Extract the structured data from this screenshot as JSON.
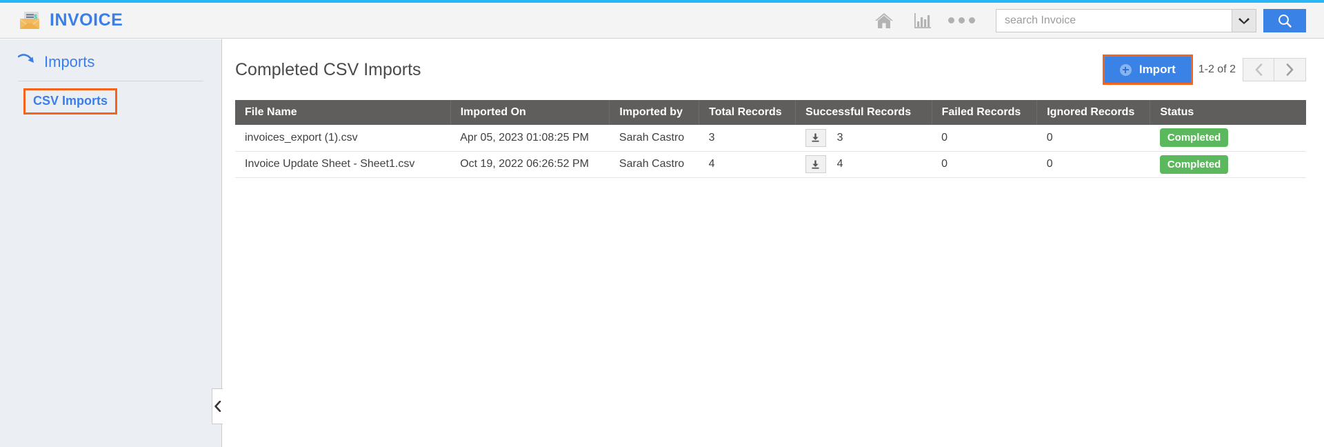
{
  "theme": {
    "accent_bar": "#29b6f6",
    "brand_blue": "#3b7ee8",
    "button_blue": "#3b82e6",
    "highlight_orange": "#f4641b",
    "table_header_gray": "#5f5e5c",
    "status_green": "#5cb85c",
    "sidebar_bg": "#ebeff4"
  },
  "header": {
    "brand_title": "INVOICE",
    "logo_icon": "envelope-invoice-icon",
    "home_icon": "home-icon",
    "analytics_icon": "bar-chart-icon",
    "more_icon": "more-dots-icon",
    "search": {
      "placeholder": "search Invoice",
      "value": "",
      "dropdown_icon": "chevron-down-icon",
      "button_icon": "search-icon"
    }
  },
  "sidebar": {
    "section_icon": "curved-arrow-icon",
    "section_label": "Imports",
    "items": [
      {
        "label": "CSV Imports",
        "selected": true
      }
    ],
    "collapse_icon": "chevron-left-icon"
  },
  "main": {
    "page_title": "Completed CSV Imports",
    "import_button": {
      "label": "Import",
      "icon": "plus-circle-icon",
      "highlighted": true
    },
    "pagination": {
      "count_text": "1-2 of 2",
      "prev_icon": "chevron-left-icon",
      "next_icon": "chevron-right-icon"
    },
    "table": {
      "columns": [
        "File Name",
        "Imported On",
        "Imported by",
        "Total Records",
        "Successful Records",
        "Failed Records",
        "Ignored Records",
        "Status"
      ],
      "rows": [
        {
          "file_name": "invoices_export (1).csv",
          "imported_on": "Apr 05, 2023 01:08:25 PM",
          "imported_by": "Sarah Castro",
          "total_records": "3",
          "download_icon": "download-icon",
          "successful_records": "3",
          "failed_records": "0",
          "ignored_records": "0",
          "status": "Completed"
        },
        {
          "file_name": "Invoice Update Sheet - Sheet1.csv",
          "imported_on": "Oct 19, 2022 06:26:52 PM",
          "imported_by": "Sarah Castro",
          "total_records": "4",
          "download_icon": "download-icon",
          "successful_records": "4",
          "failed_records": "0",
          "ignored_records": "0",
          "status": "Completed"
        }
      ]
    }
  }
}
